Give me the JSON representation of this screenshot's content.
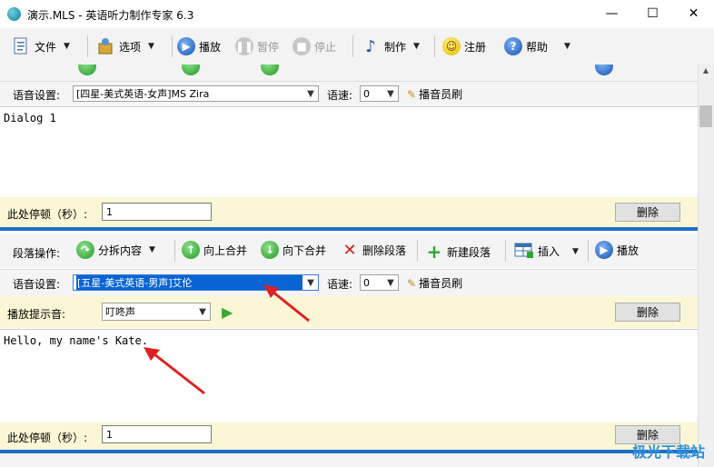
{
  "window": {
    "title": "演示.MLS - 英语听力制作专家 6.3",
    "controls": [
      "—",
      "☐",
      "✕"
    ]
  },
  "toolbar": {
    "file": "文件",
    "options": "选项",
    "play": "播放",
    "pause": "暂停",
    "stop": "停止",
    "make": "制作",
    "register": "注册",
    "help": "帮助"
  },
  "paragraph_ops": {
    "label": "段落操作:",
    "split": "分拆内容",
    "merge_up": "向上合并",
    "merge_down": "向下合并",
    "delete_para": "删除段落",
    "new_para": "新建段落",
    "insert": "插入",
    "play": "播放"
  },
  "section1": {
    "voice_label": "语音设置:",
    "voice_value": "[四星-美式英语-女声]MS Zira",
    "speed_label": "语速:",
    "speed_value": "0",
    "brush": "播音员刷",
    "text": "Dialog 1",
    "pause_label": "此处停顿（秒）:",
    "pause_value": "1",
    "delete": "删除"
  },
  "section2": {
    "voice_label": "语音设置:",
    "voice_value": "[五星-美式英语-男声]艾伦",
    "speed_label": "语速:",
    "speed_value": "0",
    "brush": "播音员刷",
    "prompt_label": "播放提示音:",
    "prompt_value": "叮咚声",
    "delete_prompt": "删除",
    "text": "Hello, my name's Kate.",
    "pause_label": "此处停顿（秒）:",
    "pause_value": "1",
    "delete": "删除"
  },
  "watermark": "极光下载站"
}
